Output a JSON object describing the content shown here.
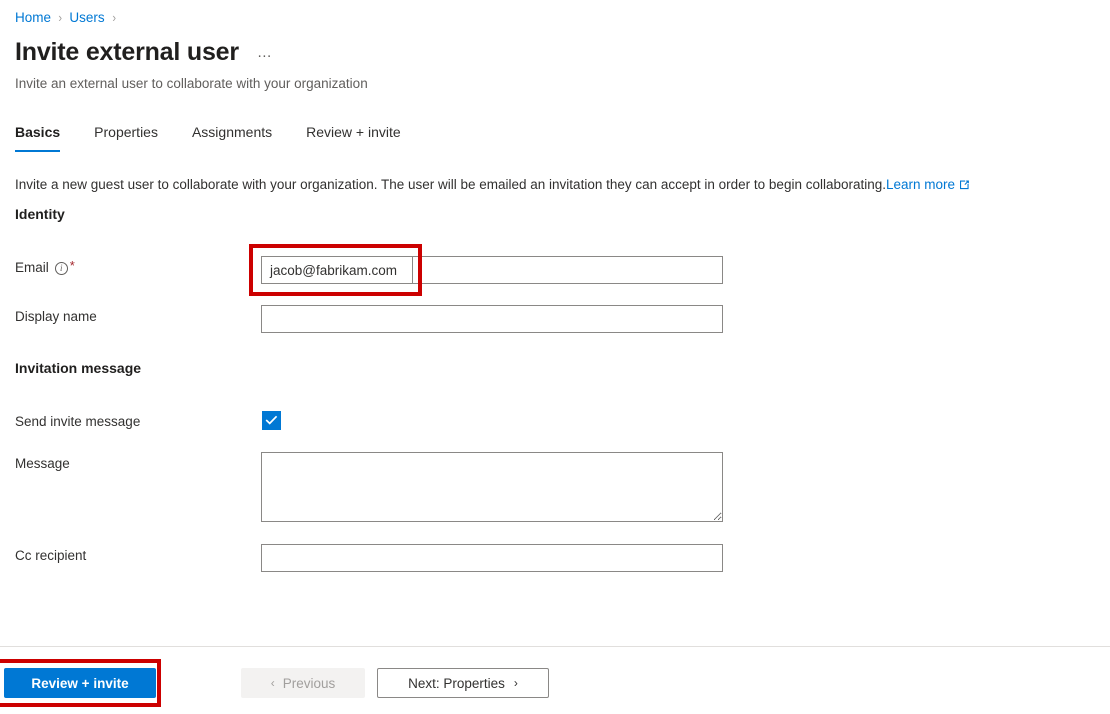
{
  "breadcrumb": {
    "items": [
      {
        "label": "Home"
      },
      {
        "label": "Users"
      }
    ],
    "separator": "›"
  },
  "header": {
    "title": "Invite external user",
    "ellipsis": "…",
    "subtitle": "Invite an external user to collaborate with your organization"
  },
  "tabs": [
    {
      "label": "Basics",
      "active": true
    },
    {
      "label": "Properties",
      "active": false
    },
    {
      "label": "Assignments",
      "active": false
    },
    {
      "label": "Review + invite",
      "active": false
    }
  ],
  "intro": {
    "text": "Invite a new guest user to collaborate with your organization. The user will be emailed an invitation they can accept in order to begin collaborating.",
    "link_label": "Learn more",
    "link_icon": "external-link-icon"
  },
  "sections": {
    "identity": "Identity",
    "invitation_message": "Invitation message"
  },
  "fields": {
    "email": {
      "label": "Email",
      "info_icon": "info-icon",
      "required_mark": "*",
      "value": "jacob@fabrikam.com",
      "placeholder": ""
    },
    "display_name": {
      "label": "Display name",
      "value": "",
      "placeholder": ""
    },
    "send_invite_message": {
      "label": "Send invite message",
      "checked": true,
      "check_glyph": "✓"
    },
    "message": {
      "label": "Message",
      "value": "",
      "placeholder": ""
    },
    "cc_recipient": {
      "label": "Cc recipient",
      "value": "",
      "placeholder": ""
    }
  },
  "footer": {
    "review_invite_label": "Review + invite",
    "previous_label": "Previous",
    "previous_chevron": "‹",
    "next_label": "Next: Properties",
    "next_chevron": "›"
  },
  "colors": {
    "accent": "#0078d4",
    "annotation": "#cc0000",
    "required": "#a4262c",
    "border": "#8a8886",
    "muted_text": "#605e5c"
  }
}
